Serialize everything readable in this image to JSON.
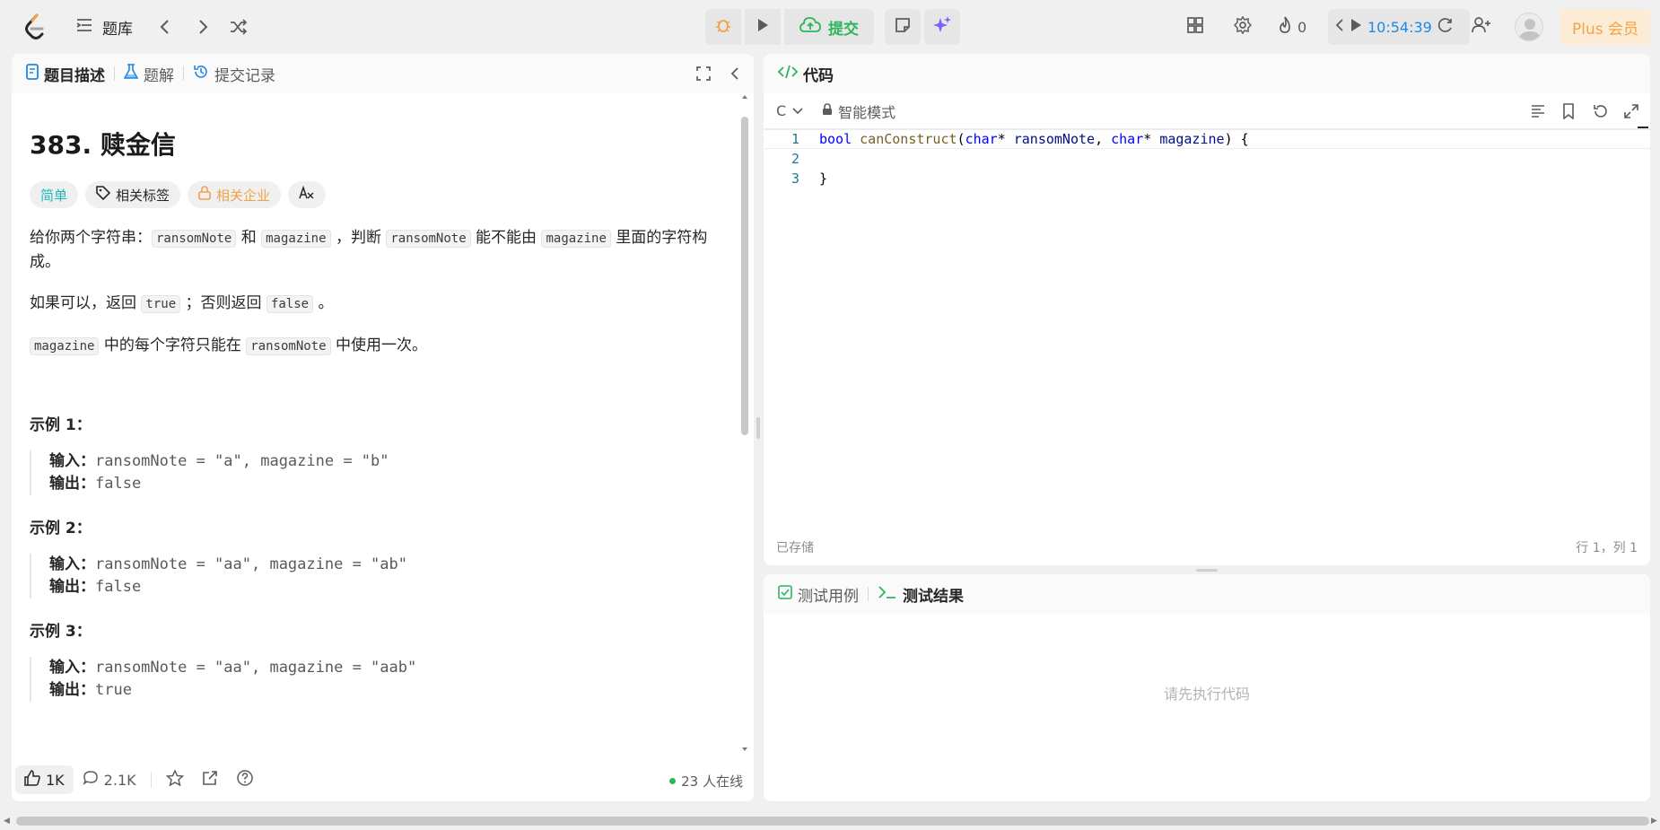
{
  "nav": {
    "problem_list": "题库",
    "submit": "提交",
    "streak": "0",
    "timer": "10:54:39",
    "plus": "Plus 会员"
  },
  "left": {
    "tabs": [
      "题目描述",
      "题解",
      "提交记录"
    ],
    "title": "383. 赎金信",
    "tags": {
      "difficulty": "简单",
      "related_tags": "相关标签",
      "company": "相关企业"
    },
    "para1": {
      "t1": "给你两个字符串：",
      "c1": "ransomNote",
      "t2": " 和 ",
      "c2": "magazine",
      "t3": " ，判断 ",
      "c3": "ransomNote",
      "t4": " 能不能由 ",
      "c4": "magazine",
      "t5": " 里面的字符构成。"
    },
    "para2": {
      "t1": "如果可以，返回 ",
      "c1": "true",
      "t2": " ；否则返回 ",
      "c2": "false",
      "t3": " 。"
    },
    "para3": {
      "c1": "magazine",
      "t1": " 中的每个字符只能在 ",
      "c2": "ransomNote",
      "t2": " 中使用一次。"
    },
    "examples": [
      {
        "title": "示例 1：",
        "input_label": "输入：",
        "input": "ransomNote = \"a\", magazine = \"b\"",
        "output_label": "输出：",
        "output": "false"
      },
      {
        "title": "示例 2：",
        "input_label": "输入：",
        "input": "ransomNote = \"aa\", magazine = \"ab\"",
        "output_label": "输出：",
        "output": "false"
      },
      {
        "title": "示例 3：",
        "input_label": "输入：",
        "input": "ransomNote = \"aa\", magazine = \"aab\"",
        "output_label": "输出：",
        "output": "true"
      }
    ],
    "footer": {
      "likes": "1K",
      "comments": "2.1K",
      "online": "23 人在线"
    }
  },
  "code": {
    "header": "代码",
    "language": "C",
    "mode": "智能模式",
    "lines": [
      "1",
      "2",
      "3"
    ],
    "code_line1": {
      "kw1": "bool",
      "fn": "canConstruct",
      "p1": "(",
      "kw2": "char",
      "s1": "* ",
      "pm1": "ransomNote",
      "s2": ", ",
      "kw3": "char",
      "s3": "* ",
      "pm2": "magazine",
      "s4": ") {"
    },
    "code_line3": "}",
    "saved": "已存储",
    "position": "行 1，列 1"
  },
  "result": {
    "tab_testcase": "测试用例",
    "tab_result": "测试结果",
    "empty": "请先执行代码"
  },
  "colors": {
    "accent_green": "#2db55d",
    "timer_blue": "#1e88e5",
    "plus_orange": "#f0a34a"
  }
}
